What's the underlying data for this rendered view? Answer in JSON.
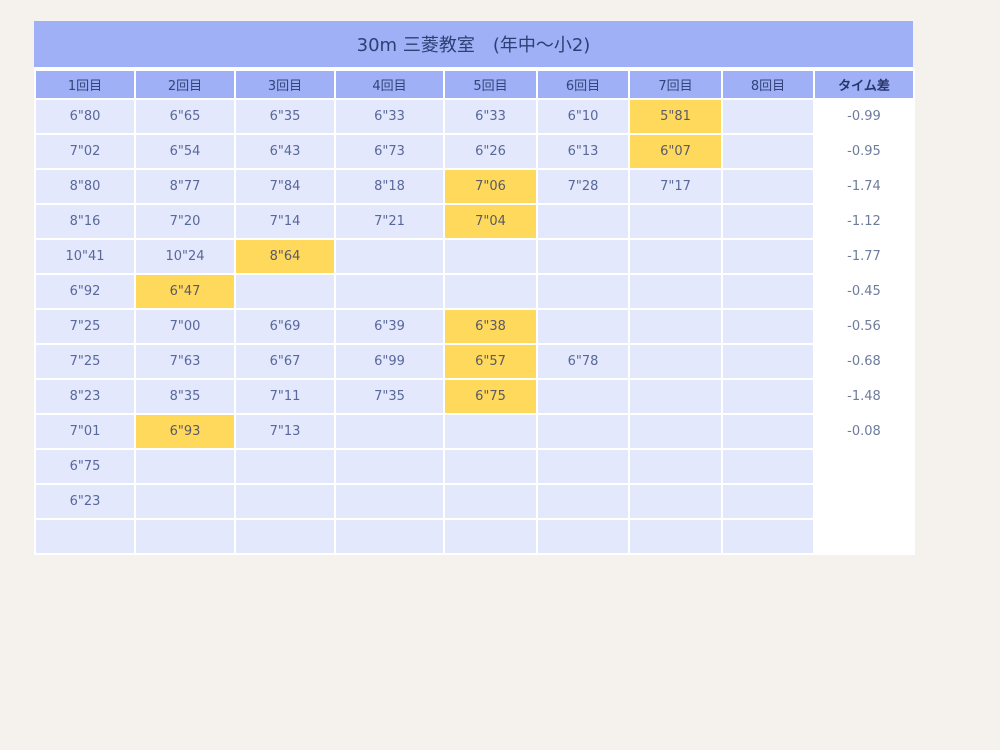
{
  "title": "30m 三菱教室　(年中〜小2)",
  "headers": [
    "1回目",
    "2回目",
    "3回目",
    "4回目",
    "5回目",
    "6回目",
    "7回目",
    "8回目",
    "タイム差"
  ],
  "rows": [
    {
      "times": [
        "6\"80",
        "6\"65",
        "6\"35",
        "6\"33",
        "6\"33",
        "6\"10",
        "5\"81",
        ""
      ],
      "best_index": 6,
      "diff": "-0.99"
    },
    {
      "times": [
        "7\"02",
        "6\"54",
        "6\"43",
        "6\"73",
        "6\"26",
        "6\"13",
        "6\"07",
        ""
      ],
      "best_index": 6,
      "diff": "-0.95"
    },
    {
      "times": [
        "8\"80",
        "8\"77",
        "7\"84",
        "8\"18",
        "7\"06",
        "7\"28",
        "7\"17",
        ""
      ],
      "best_index": 4,
      "diff": "-1.74"
    },
    {
      "times": [
        "8\"16",
        "7\"20",
        "7\"14",
        "7\"21",
        "7\"04",
        "",
        "",
        ""
      ],
      "best_index": 4,
      "diff": "-1.12"
    },
    {
      "times": [
        "10\"41",
        "10\"24",
        "8\"64",
        "",
        "",
        "",
        "",
        ""
      ],
      "best_index": 2,
      "diff": "-1.77"
    },
    {
      "times": [
        "6\"92",
        "6\"47",
        "",
        "",
        "",
        "",
        "",
        ""
      ],
      "best_index": 1,
      "diff": "-0.45"
    },
    {
      "times": [
        "7\"25",
        "7\"00",
        "6\"69",
        "6\"39",
        "6\"38",
        "",
        "",
        ""
      ],
      "best_index": 4,
      "diff": "-0.56"
    },
    {
      "times": [
        "7\"25",
        "7\"63",
        "6\"67",
        "6\"99",
        "6\"57",
        "6\"78",
        "",
        ""
      ],
      "best_index": 4,
      "diff": "-0.68"
    },
    {
      "times": [
        "8\"23",
        "8\"35",
        "7\"11",
        "7\"35",
        "6\"75",
        "",
        "",
        ""
      ],
      "best_index": 4,
      "diff": "-1.48"
    },
    {
      "times": [
        "7\"01",
        "6\"93",
        "7\"13",
        "",
        "",
        "",
        "",
        ""
      ],
      "best_index": 1,
      "diff": "-0.08"
    },
    {
      "times": [
        "6\"75",
        "",
        "",
        "",
        "",
        "",
        "",
        ""
      ],
      "best_index": -1,
      "diff": ""
    },
    {
      "times": [
        "6\"23",
        "",
        "",
        "",
        "",
        "",
        "",
        ""
      ],
      "best_index": -1,
      "diff": ""
    },
    {
      "times": [
        "",
        "",
        "",
        "",
        "",
        "",
        "",
        ""
      ],
      "best_index": -1,
      "diff": ""
    }
  ],
  "colors": {
    "header_bg": "#9fb0f7",
    "cell_bg": "#e3e8fd",
    "best_highlight": "#ffd95c",
    "diff_bg": "#ffffff"
  }
}
